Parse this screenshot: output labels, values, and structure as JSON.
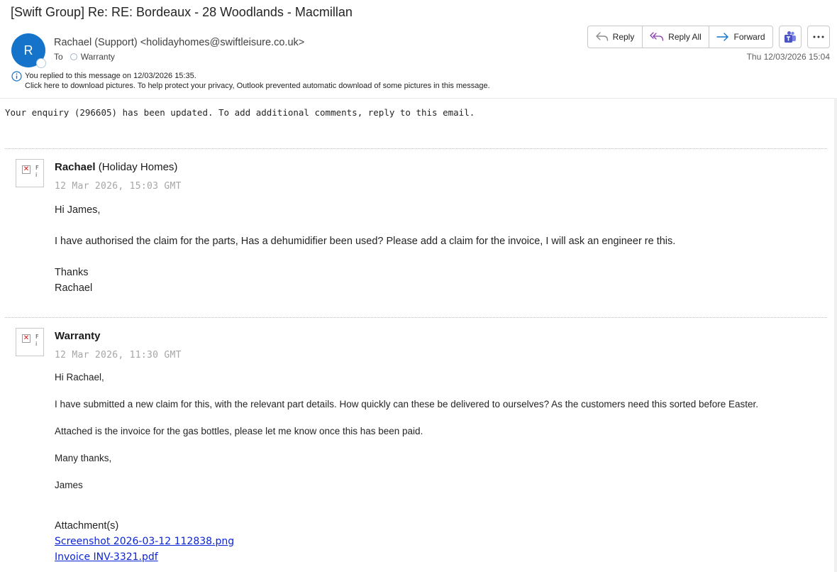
{
  "email": {
    "subject": "[Swift Group] Re: RE: Bordeaux - 28 Woodlands - Macmillan",
    "avatar_initial": "R",
    "sender": "Rachael (Support) <holidayhomes@swiftleisure.co.uk>",
    "to_label": "To",
    "to_name": "Warranty",
    "date": "Thu 12/03/2026 15:04",
    "actions": {
      "reply": "Reply",
      "reply_all": "Reply All",
      "forward": "Forward"
    },
    "info": {
      "replied": "You replied to this message on 12/03/2026 15:35.",
      "pictures": "Click here to download pictures. To help protect your privacy, Outlook prevented automatic download of some pictures in this message."
    }
  },
  "body": {
    "enquiry": "Your enquiry (296605) has been updated. To add additional comments, reply to this email.",
    "messages": [
      {
        "image_alt": "F\ni",
        "name_bold": "Rachael",
        "name_rest": " (Holiday Homes)",
        "time": "12 Mar 2026, 15:03 GMT",
        "lines": [
          "Hi James,",
          "I have authorised the claim for the parts, Has a dehumidifier been used? Please add a claim for the invoice, I will ask an engineer re this.",
          "Thanks",
          "Rachael"
        ]
      },
      {
        "image_alt": "F\ni",
        "name_bold": "Warranty",
        "name_rest": "",
        "time": "12 Mar 2026, 11:30 GMT",
        "lines": [
          "Hi Rachael,",
          "I have submitted a new claim for this, with the relevant part details. How quickly can these be delivered to ourselves? As the customers need this sorted before Easter.",
          "Attached is the invoice for the gas bottles, please let me know once this has been paid.",
          "Many thanks,",
          "James"
        ],
        "attachments_label": "Attachment(s)",
        "attachments": [
          "Screenshot 2026-03-12 112838.png",
          "Invoice INV-3321.pdf"
        ]
      }
    ]
  },
  "colors": {
    "avatar": "#1574c9",
    "link": "#0b24d6",
    "reply_icon": "#8e8e8e",
    "reply_all_icon": "#8a3fae",
    "forward_icon": "#1574c9",
    "teams_icon": "#5b5fc7"
  },
  "icons": [
    "reply-icon",
    "reply-all-icon",
    "forward-icon",
    "teams-icon",
    "more-icon",
    "info-icon",
    "broken-image-icon"
  ]
}
